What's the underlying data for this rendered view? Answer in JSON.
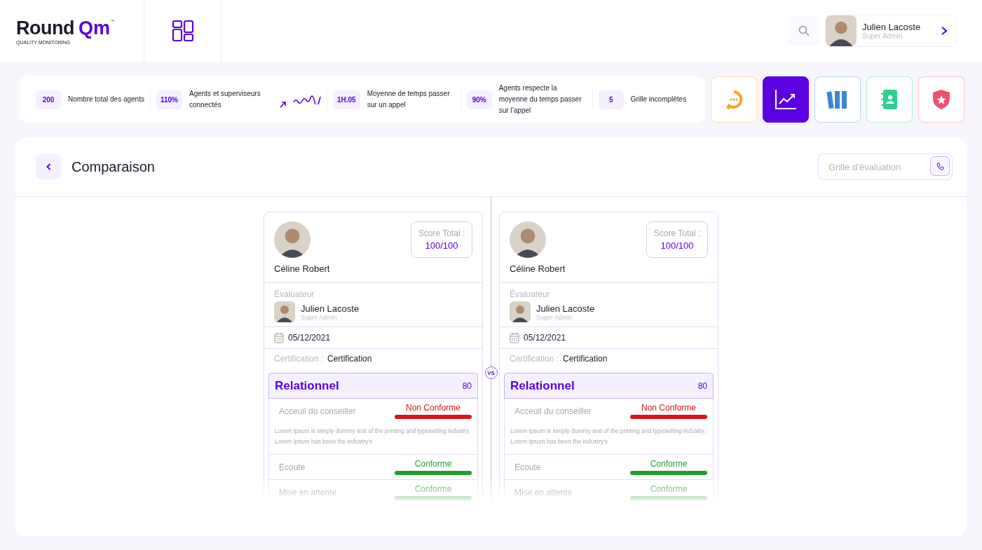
{
  "logo": {
    "word": "Round",
    "accent": "Qm",
    "trademark": "™",
    "tagline": "QUALITY MONITORING"
  },
  "user": {
    "name": "Julien Lacoste",
    "role": "Super Admin"
  },
  "stats": [
    {
      "value": "200",
      "label": "Nombre total des agents",
      "kind": "plain"
    },
    {
      "value": "110%",
      "label": "Agents et superviseurs connectés",
      "kind": "trend"
    },
    {
      "value": "1H.05",
      "label": "Moyenne de temps passer sur un appel",
      "kind": "plain"
    },
    {
      "value": "90%",
      "label": "Agents respecte la moyenne du temps passer sur l’appel",
      "kind": "plain"
    },
    {
      "value": "5",
      "label": "Grille incomplètes",
      "kind": "plain"
    }
  ],
  "tiles": [
    {
      "kind": "chat",
      "color": "#f5a41b",
      "selected": false
    },
    {
      "kind": "chart",
      "color": "#5b00e0",
      "selected": true
    },
    {
      "kind": "binders",
      "color": "#3b86d6",
      "selected": false
    },
    {
      "kind": "contacts",
      "color": "#2fd08f",
      "selected": false
    },
    {
      "kind": "badge",
      "color": "#f0506e",
      "selected": false
    }
  ],
  "page": {
    "title": "Comparaison",
    "grid_field": {
      "placeholder": "Grille d’évaluation"
    },
    "vs": "VS"
  },
  "cards": [
    {
      "agent": "Céline Robert",
      "score_label": "Score Total :",
      "score": "100/100",
      "evaluator_label": "Évaluateur",
      "evaluator": "Julien Lacoste",
      "evaluator_role": "Super Admin",
      "date": "05/12/2021",
      "cert_label": "Certification :",
      "cert": "Certification",
      "section": "Relationnel",
      "section_score": "80",
      "criteria": [
        {
          "name": "Acceuil du conseiller",
          "status": "Non Conforme",
          "conform": false,
          "description": "Lorem Ipsum is simply dummy text of the printing and typesetting industry. Lorem Ipsum has been the industry's"
        },
        {
          "name": "Ecoute",
          "status": "Conforme",
          "conform": true
        },
        {
          "name": "Mise en attente",
          "status": "Conforme",
          "conform": true
        }
      ]
    },
    {
      "agent": "Céline Robert",
      "score_label": "Score Total :",
      "score": "100/100",
      "evaluator_label": "Évaluateur",
      "evaluator": "Julien Lacoste",
      "evaluator_role": "Super Admin",
      "date": "05/12/2021",
      "cert_label": "Certification :",
      "cert": "Certification",
      "section": "Relationnel",
      "section_score": "80",
      "criteria": [
        {
          "name": "Acceuil du conseiller",
          "status": "Non Conforme",
          "conform": false,
          "description": "Lorem Ipsum is simply dummy text of the printing and typesetting industry. Lorem Ipsum has been the industry's"
        },
        {
          "name": "Ecoute",
          "status": "Conforme",
          "conform": true
        },
        {
          "name": "Mise en attente",
          "status": "Conforme",
          "conform": true
        }
      ]
    }
  ]
}
